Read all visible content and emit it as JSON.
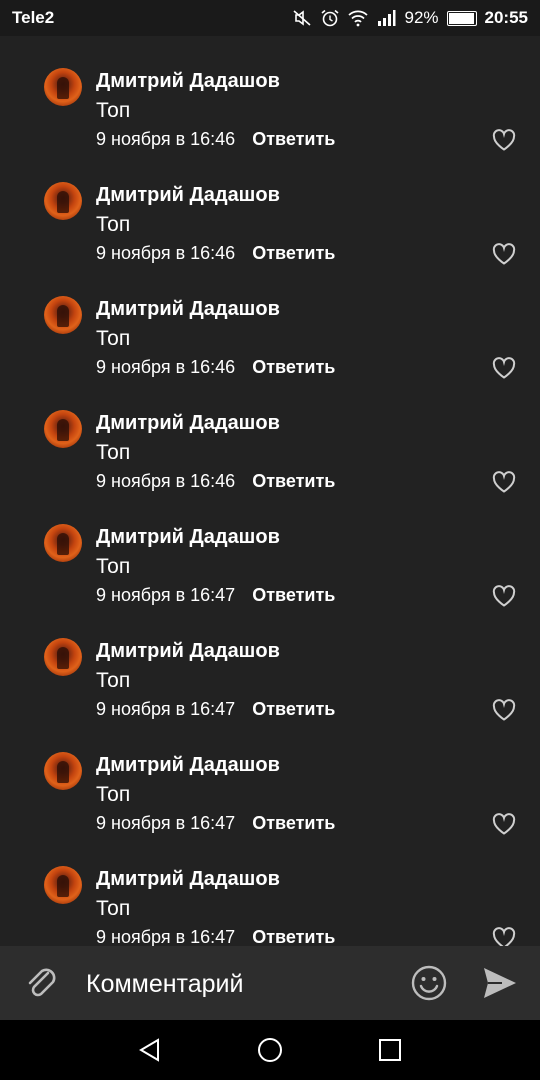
{
  "status": {
    "carrier": "Tele2",
    "battery": "92%",
    "time": "20:55"
  },
  "comments": [
    {
      "author": "Дмитрий Дадашов",
      "text": "Топ",
      "date": "9 ноября в 16:46",
      "reply": "Ответить"
    },
    {
      "author": "Дмитрий Дадашов",
      "text": "Топ",
      "date": "9 ноября в 16:46",
      "reply": "Ответить"
    },
    {
      "author": "Дмитрий Дадашов",
      "text": "Топ",
      "date": "9 ноября в 16:46",
      "reply": "Ответить"
    },
    {
      "author": "Дмитрий Дадашов",
      "text": "Топ",
      "date": "9 ноября в 16:46",
      "reply": "Ответить"
    },
    {
      "author": "Дмитрий Дадашов",
      "text": "Топ",
      "date": "9 ноября в 16:47",
      "reply": "Ответить"
    },
    {
      "author": "Дмитрий Дадашов",
      "text": "Топ",
      "date": "9 ноября в 16:47",
      "reply": "Ответить"
    },
    {
      "author": "Дмитрий Дадашов",
      "text": "Топ",
      "date": "9 ноября в 16:47",
      "reply": "Ответить"
    },
    {
      "author": "Дмитрий Дадашов",
      "text": "Топ",
      "date": "9 ноября в 16:47",
      "reply": "Ответить"
    }
  ],
  "composer": {
    "placeholder": "Комментарий",
    "icons": [
      "paperclip-icon",
      "emoji-icon",
      "send-icon"
    ]
  },
  "navbar": {
    "icons": [
      "back-icon",
      "home-icon",
      "recents-icon"
    ]
  },
  "colors": {
    "background": "#222222",
    "statusbar": "#1a1a1a",
    "composer": "#2d2d2d",
    "navbar": "#000000",
    "text": "#ffffff"
  }
}
